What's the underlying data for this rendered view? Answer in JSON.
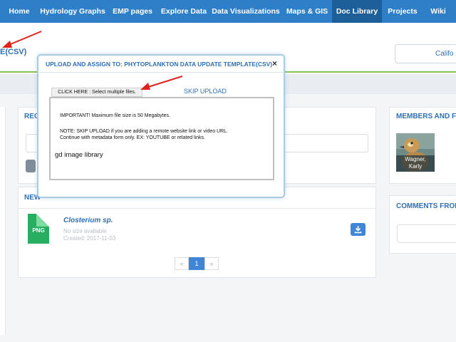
{
  "nav": {
    "items": [
      {
        "label": "Home"
      },
      {
        "label": "Hydrology Graphs"
      },
      {
        "label": "EMP pages"
      },
      {
        "label": "Explore Data"
      },
      {
        "label": "Data Visualizations"
      },
      {
        "label": "Maps & GIS"
      },
      {
        "label": "Doc Library",
        "active": true
      },
      {
        "label": "Projects"
      },
      {
        "label": "Wiki"
      }
    ],
    "color": "#2e7fc8",
    "active_color": "#1d5f99"
  },
  "header": {
    "title_fragment": "E(CSV)",
    "select_value": "Califo"
  },
  "panels": {
    "recent_title": "REC",
    "newest_title": "NEW",
    "members_title": "MEMBERS AND FO",
    "comments_title": "COMMENTS FROM"
  },
  "file": {
    "type_label": "PNG",
    "name": "Closterium sp.",
    "size": "No size available",
    "created": "Created: 2017-11-03"
  },
  "pagination": {
    "prev": "«",
    "current": "1",
    "next": "»"
  },
  "member": {
    "name_line1": "Wagner,",
    "name_line2": "Karly"
  },
  "modal": {
    "title": "UPLOAD AND ASSIGN TO: PHYTOPLANKTON DATA UPDATE TEMPLATE(CSV)",
    "close": "×",
    "choose_files": "CLICK HERE : Select multiple files.",
    "skip_upload": "SKIP UPLOAD",
    "important": "IMPORTANT! Maximum file size is 50 Megabytes.",
    "note_line1": "NOTE: SKIP UPLOAD if you are adding a remote website link or video URL.",
    "note_line2": "Continue with metadata form only. EX: YOUTUBE or related links.",
    "library_name": "gd image library"
  },
  "annotation": {
    "arrow_color": "#e0211c"
  },
  "icons": {
    "download": "download-icon",
    "close": "close-icon",
    "file": "png-file-icon",
    "arrow": "red-arrow-annotation"
  }
}
